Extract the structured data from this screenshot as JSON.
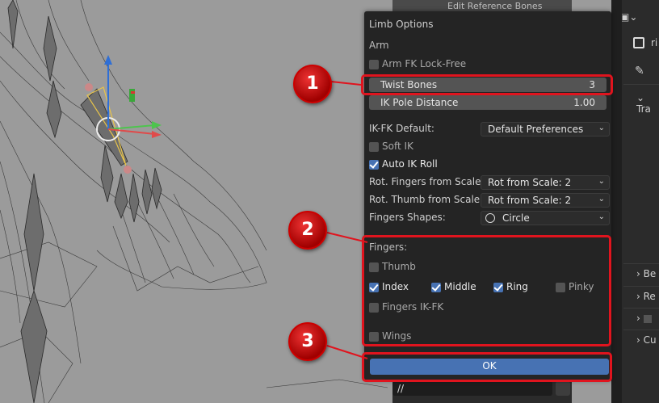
{
  "header_strip": {
    "label": "Edit Reference Bones"
  },
  "dialog": {
    "title": "Limb Options",
    "section": "Arm",
    "arm_fk_lock_free": {
      "label": "Arm FK Lock-Free",
      "checked": false
    },
    "twist_bones": {
      "label": "Twist Bones",
      "value": "3"
    },
    "ik_pole_distance": {
      "label": "IK Pole Distance",
      "value": "1.00"
    },
    "ikfk_default": {
      "label": "IK-FK Default:",
      "value": "Default Preferences"
    },
    "soft_ik": {
      "label": "Soft IK",
      "checked": false
    },
    "auto_ik_roll": {
      "label": "Auto IK Roll",
      "checked": true
    },
    "rot_fingers": {
      "label": "Rot. Fingers from Scale:",
      "value": "Rot from Scale: 2"
    },
    "rot_thumb": {
      "label": "Rot. Thumb from Scale:",
      "value": "Rot from Scale: 2"
    },
    "fingers_shapes": {
      "label": "Fingers Shapes:",
      "value": "Circle"
    },
    "fingers": {
      "label": "Fingers:",
      "thumb": {
        "label": "Thumb",
        "checked": false
      },
      "index": {
        "label": "Index",
        "checked": true
      },
      "middle": {
        "label": "Middle",
        "checked": true
      },
      "ring": {
        "label": "Ring",
        "checked": true
      },
      "pinky": {
        "label": "Pinky",
        "checked": false
      },
      "fingers_ikfk": {
        "label": "Fingers IK-FK",
        "checked": false
      }
    },
    "wings": {
      "label": "Wings",
      "checked": false
    },
    "ok": "OK"
  },
  "below_dialog": {
    "path": "//"
  },
  "right_panel": {
    "top": "ri",
    "tab1": "Tra",
    "tab2": "Be",
    "tab3": "Re",
    "tab4": "Cu"
  },
  "badges": [
    "1",
    "2",
    "3"
  ],
  "colors": {
    "accent": "#4772b3",
    "highlight": "#e0141e",
    "panel": "#242424"
  }
}
